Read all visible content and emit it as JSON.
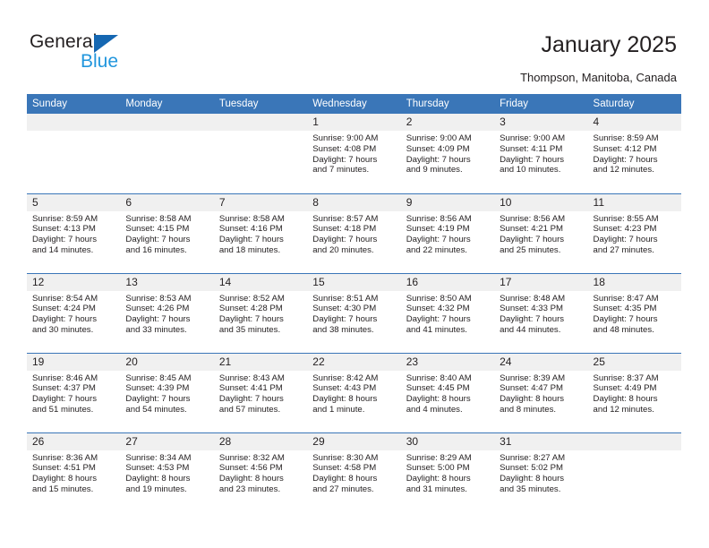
{
  "brand": {
    "name_part1": "General",
    "name_part2": "Blue",
    "accent_color": "#1567b2",
    "accent_color_light": "#2196dd"
  },
  "header": {
    "title": "January 2025",
    "location": "Thompson, Manitoba, Canada"
  },
  "theme": {
    "header_row_bg": "#3a76b8",
    "daynum_bg": "#f0f0f0",
    "text_color": "#231f20"
  },
  "weekday_headers": [
    "Sunday",
    "Monday",
    "Tuesday",
    "Wednesday",
    "Thursday",
    "Friday",
    "Saturday"
  ],
  "labels": {
    "sunrise_prefix": "Sunrise:",
    "sunset_prefix": "Sunset:",
    "daylight_prefix": "Daylight:"
  },
  "weeks": [
    [
      {
        "day": "",
        "l1": "",
        "l2": "",
        "l3": "",
        "l4": ""
      },
      {
        "day": "",
        "l1": "",
        "l2": "",
        "l3": "",
        "l4": ""
      },
      {
        "day": "",
        "l1": "",
        "l2": "",
        "l3": "",
        "l4": ""
      },
      {
        "day": "1",
        "l1": "Sunrise: 9:00 AM",
        "l2": "Sunset: 4:08 PM",
        "l3": "Daylight: 7 hours",
        "l4": "and 7 minutes."
      },
      {
        "day": "2",
        "l1": "Sunrise: 9:00 AM",
        "l2": "Sunset: 4:09 PM",
        "l3": "Daylight: 7 hours",
        "l4": "and 9 minutes."
      },
      {
        "day": "3",
        "l1": "Sunrise: 9:00 AM",
        "l2": "Sunset: 4:11 PM",
        "l3": "Daylight: 7 hours",
        "l4": "and 10 minutes."
      },
      {
        "day": "4",
        "l1": "Sunrise: 8:59 AM",
        "l2": "Sunset: 4:12 PM",
        "l3": "Daylight: 7 hours",
        "l4": "and 12 minutes."
      }
    ],
    [
      {
        "day": "5",
        "l1": "Sunrise: 8:59 AM",
        "l2": "Sunset: 4:13 PM",
        "l3": "Daylight: 7 hours",
        "l4": "and 14 minutes."
      },
      {
        "day": "6",
        "l1": "Sunrise: 8:58 AM",
        "l2": "Sunset: 4:15 PM",
        "l3": "Daylight: 7 hours",
        "l4": "and 16 minutes."
      },
      {
        "day": "7",
        "l1": "Sunrise: 8:58 AM",
        "l2": "Sunset: 4:16 PM",
        "l3": "Daylight: 7 hours",
        "l4": "and 18 minutes."
      },
      {
        "day": "8",
        "l1": "Sunrise: 8:57 AM",
        "l2": "Sunset: 4:18 PM",
        "l3": "Daylight: 7 hours",
        "l4": "and 20 minutes."
      },
      {
        "day": "9",
        "l1": "Sunrise: 8:56 AM",
        "l2": "Sunset: 4:19 PM",
        "l3": "Daylight: 7 hours",
        "l4": "and 22 minutes."
      },
      {
        "day": "10",
        "l1": "Sunrise: 8:56 AM",
        "l2": "Sunset: 4:21 PM",
        "l3": "Daylight: 7 hours",
        "l4": "and 25 minutes."
      },
      {
        "day": "11",
        "l1": "Sunrise: 8:55 AM",
        "l2": "Sunset: 4:23 PM",
        "l3": "Daylight: 7 hours",
        "l4": "and 27 minutes."
      }
    ],
    [
      {
        "day": "12",
        "l1": "Sunrise: 8:54 AM",
        "l2": "Sunset: 4:24 PM",
        "l3": "Daylight: 7 hours",
        "l4": "and 30 minutes."
      },
      {
        "day": "13",
        "l1": "Sunrise: 8:53 AM",
        "l2": "Sunset: 4:26 PM",
        "l3": "Daylight: 7 hours",
        "l4": "and 33 minutes."
      },
      {
        "day": "14",
        "l1": "Sunrise: 8:52 AM",
        "l2": "Sunset: 4:28 PM",
        "l3": "Daylight: 7 hours",
        "l4": "and 35 minutes."
      },
      {
        "day": "15",
        "l1": "Sunrise: 8:51 AM",
        "l2": "Sunset: 4:30 PM",
        "l3": "Daylight: 7 hours",
        "l4": "and 38 minutes."
      },
      {
        "day": "16",
        "l1": "Sunrise: 8:50 AM",
        "l2": "Sunset: 4:32 PM",
        "l3": "Daylight: 7 hours",
        "l4": "and 41 minutes."
      },
      {
        "day": "17",
        "l1": "Sunrise: 8:48 AM",
        "l2": "Sunset: 4:33 PM",
        "l3": "Daylight: 7 hours",
        "l4": "and 44 minutes."
      },
      {
        "day": "18",
        "l1": "Sunrise: 8:47 AM",
        "l2": "Sunset: 4:35 PM",
        "l3": "Daylight: 7 hours",
        "l4": "and 48 minutes."
      }
    ],
    [
      {
        "day": "19",
        "l1": "Sunrise: 8:46 AM",
        "l2": "Sunset: 4:37 PM",
        "l3": "Daylight: 7 hours",
        "l4": "and 51 minutes."
      },
      {
        "day": "20",
        "l1": "Sunrise: 8:45 AM",
        "l2": "Sunset: 4:39 PM",
        "l3": "Daylight: 7 hours",
        "l4": "and 54 minutes."
      },
      {
        "day": "21",
        "l1": "Sunrise: 8:43 AM",
        "l2": "Sunset: 4:41 PM",
        "l3": "Daylight: 7 hours",
        "l4": "and 57 minutes."
      },
      {
        "day": "22",
        "l1": "Sunrise: 8:42 AM",
        "l2": "Sunset: 4:43 PM",
        "l3": "Daylight: 8 hours",
        "l4": "and 1 minute."
      },
      {
        "day": "23",
        "l1": "Sunrise: 8:40 AM",
        "l2": "Sunset: 4:45 PM",
        "l3": "Daylight: 8 hours",
        "l4": "and 4 minutes."
      },
      {
        "day": "24",
        "l1": "Sunrise: 8:39 AM",
        "l2": "Sunset: 4:47 PM",
        "l3": "Daylight: 8 hours",
        "l4": "and 8 minutes."
      },
      {
        "day": "25",
        "l1": "Sunrise: 8:37 AM",
        "l2": "Sunset: 4:49 PM",
        "l3": "Daylight: 8 hours",
        "l4": "and 12 minutes."
      }
    ],
    [
      {
        "day": "26",
        "l1": "Sunrise: 8:36 AM",
        "l2": "Sunset: 4:51 PM",
        "l3": "Daylight: 8 hours",
        "l4": "and 15 minutes."
      },
      {
        "day": "27",
        "l1": "Sunrise: 8:34 AM",
        "l2": "Sunset: 4:53 PM",
        "l3": "Daylight: 8 hours",
        "l4": "and 19 minutes."
      },
      {
        "day": "28",
        "l1": "Sunrise: 8:32 AM",
        "l2": "Sunset: 4:56 PM",
        "l3": "Daylight: 8 hours",
        "l4": "and 23 minutes."
      },
      {
        "day": "29",
        "l1": "Sunrise: 8:30 AM",
        "l2": "Sunset: 4:58 PM",
        "l3": "Daylight: 8 hours",
        "l4": "and 27 minutes."
      },
      {
        "day": "30",
        "l1": "Sunrise: 8:29 AM",
        "l2": "Sunset: 5:00 PM",
        "l3": "Daylight: 8 hours",
        "l4": "and 31 minutes."
      },
      {
        "day": "31",
        "l1": "Sunrise: 8:27 AM",
        "l2": "Sunset: 5:02 PM",
        "l3": "Daylight: 8 hours",
        "l4": "and 35 minutes."
      },
      {
        "day": "",
        "l1": "",
        "l2": "",
        "l3": "",
        "l4": ""
      }
    ]
  ]
}
